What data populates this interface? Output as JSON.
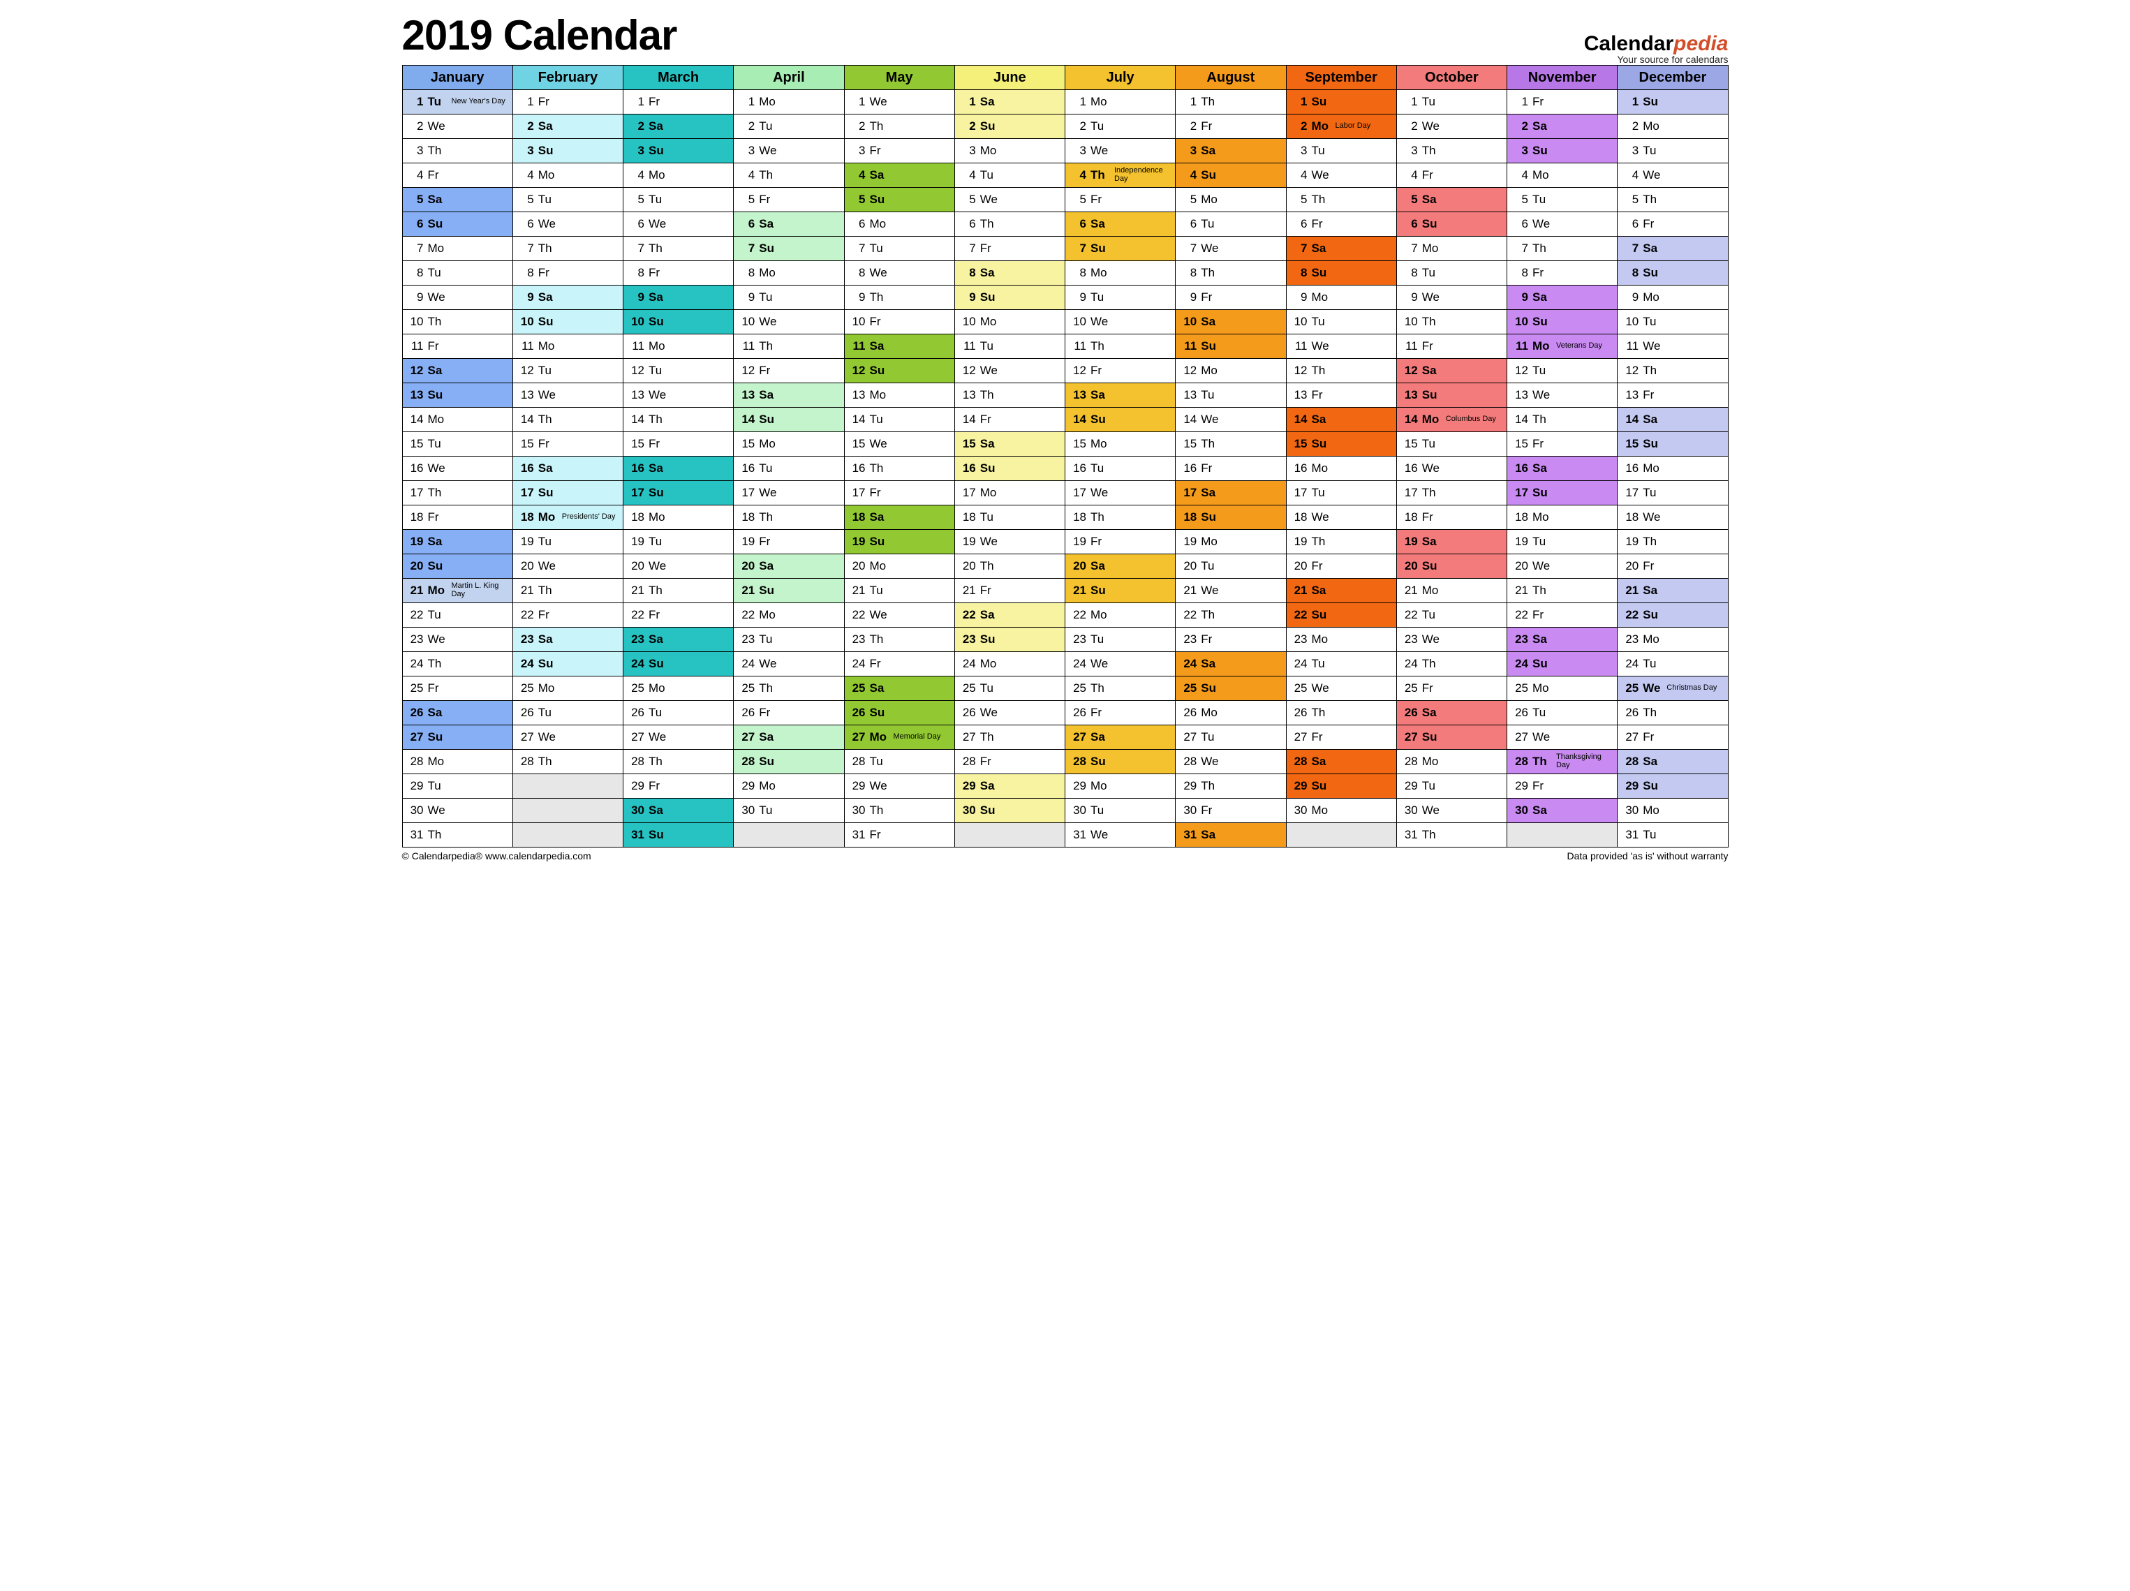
{
  "title": "2019 Calendar",
  "brand": {
    "name_a": "Calendar",
    "name_b": "pedia",
    "tag": "Your source for calendars"
  },
  "footer": {
    "left": "© Calendarpedia®   www.calendarpedia.com",
    "right": "Data provided 'as is' without warranty"
  },
  "dow_labels": [
    "Su",
    "Mo",
    "Tu",
    "We",
    "Th",
    "Fr",
    "Sa"
  ],
  "months": [
    {
      "name": "January",
      "first_dow": 2,
      "days": 31,
      "hdr": "#80abec",
      "wknd": "#87aff5",
      "hol": "#c2d3ef",
      "holidays": [
        {
          "d": 1,
          "t": "New Year's Day"
        },
        {
          "d": 21,
          "t": "Martin L. King Day"
        }
      ]
    },
    {
      "name": "February",
      "first_dow": 5,
      "days": 28,
      "hdr": "#6fd3e3",
      "wknd": "#c9f4fa",
      "hol": "#c9f4fa",
      "holidays": [
        {
          "d": 18,
          "t": "Presidents' Day"
        }
      ]
    },
    {
      "name": "March",
      "first_dow": 5,
      "days": 31,
      "hdr": "#27c2c2",
      "wknd": "#27c2c2",
      "hol": "#27c2c2",
      "holidays": []
    },
    {
      "name": "April",
      "first_dow": 1,
      "days": 30,
      "hdr": "#a7edb4",
      "wknd": "#c4f4cb",
      "hol": "#c4f4cb",
      "holidays": []
    },
    {
      "name": "May",
      "first_dow": 3,
      "days": 31,
      "hdr": "#92c933",
      "wknd": "#92c933",
      "hol": "#92c933",
      "holidays": [
        {
          "d": 27,
          "t": "Memorial Day"
        }
      ]
    },
    {
      "name": "June",
      "first_dow": 6,
      "days": 30,
      "hdr": "#f4f07a",
      "wknd": "#f7f3a0",
      "hol": "#f7f3a0",
      "holidays": []
    },
    {
      "name": "July",
      "first_dow": 1,
      "days": 31,
      "hdr": "#f4c22e",
      "wknd": "#f4c22e",
      "hol": "#f4c22e",
      "holidays": [
        {
          "d": 4,
          "t": "Independence Day"
        }
      ]
    },
    {
      "name": "August",
      "first_dow": 4,
      "days": 31,
      "hdr": "#f59b1c",
      "wknd": "#f59b1c",
      "hol": "#f59b1c",
      "holidays": []
    },
    {
      "name": "September",
      "first_dow": 0,
      "days": 30,
      "hdr": "#f26711",
      "wknd": "#f26711",
      "hol": "#f26711",
      "holidays": [
        {
          "d": 2,
          "t": "Labor Day"
        }
      ]
    },
    {
      "name": "October",
      "first_dow": 2,
      "days": 31,
      "hdr": "#f47b7b",
      "wknd": "#f47b7b",
      "hol": "#f47b7b",
      "holidays": [
        {
          "d": 14,
          "t": "Columbus Day"
        }
      ]
    },
    {
      "name": "November",
      "first_dow": 5,
      "days": 30,
      "hdr": "#b777e6",
      "wknd": "#c98bf2",
      "hol": "#c98bf2",
      "holidays": [
        {
          "d": 11,
          "t": "Veterans Day"
        },
        {
          "d": 28,
          "t": "Thanksgiving Day"
        }
      ]
    },
    {
      "name": "December",
      "first_dow": 0,
      "days": 31,
      "hdr": "#9ca8e6",
      "wknd": "#c4c9f2",
      "hol": "#c4c9f2",
      "holidays": [
        {
          "d": 25,
          "t": "Christmas Day"
        }
      ]
    }
  ]
}
